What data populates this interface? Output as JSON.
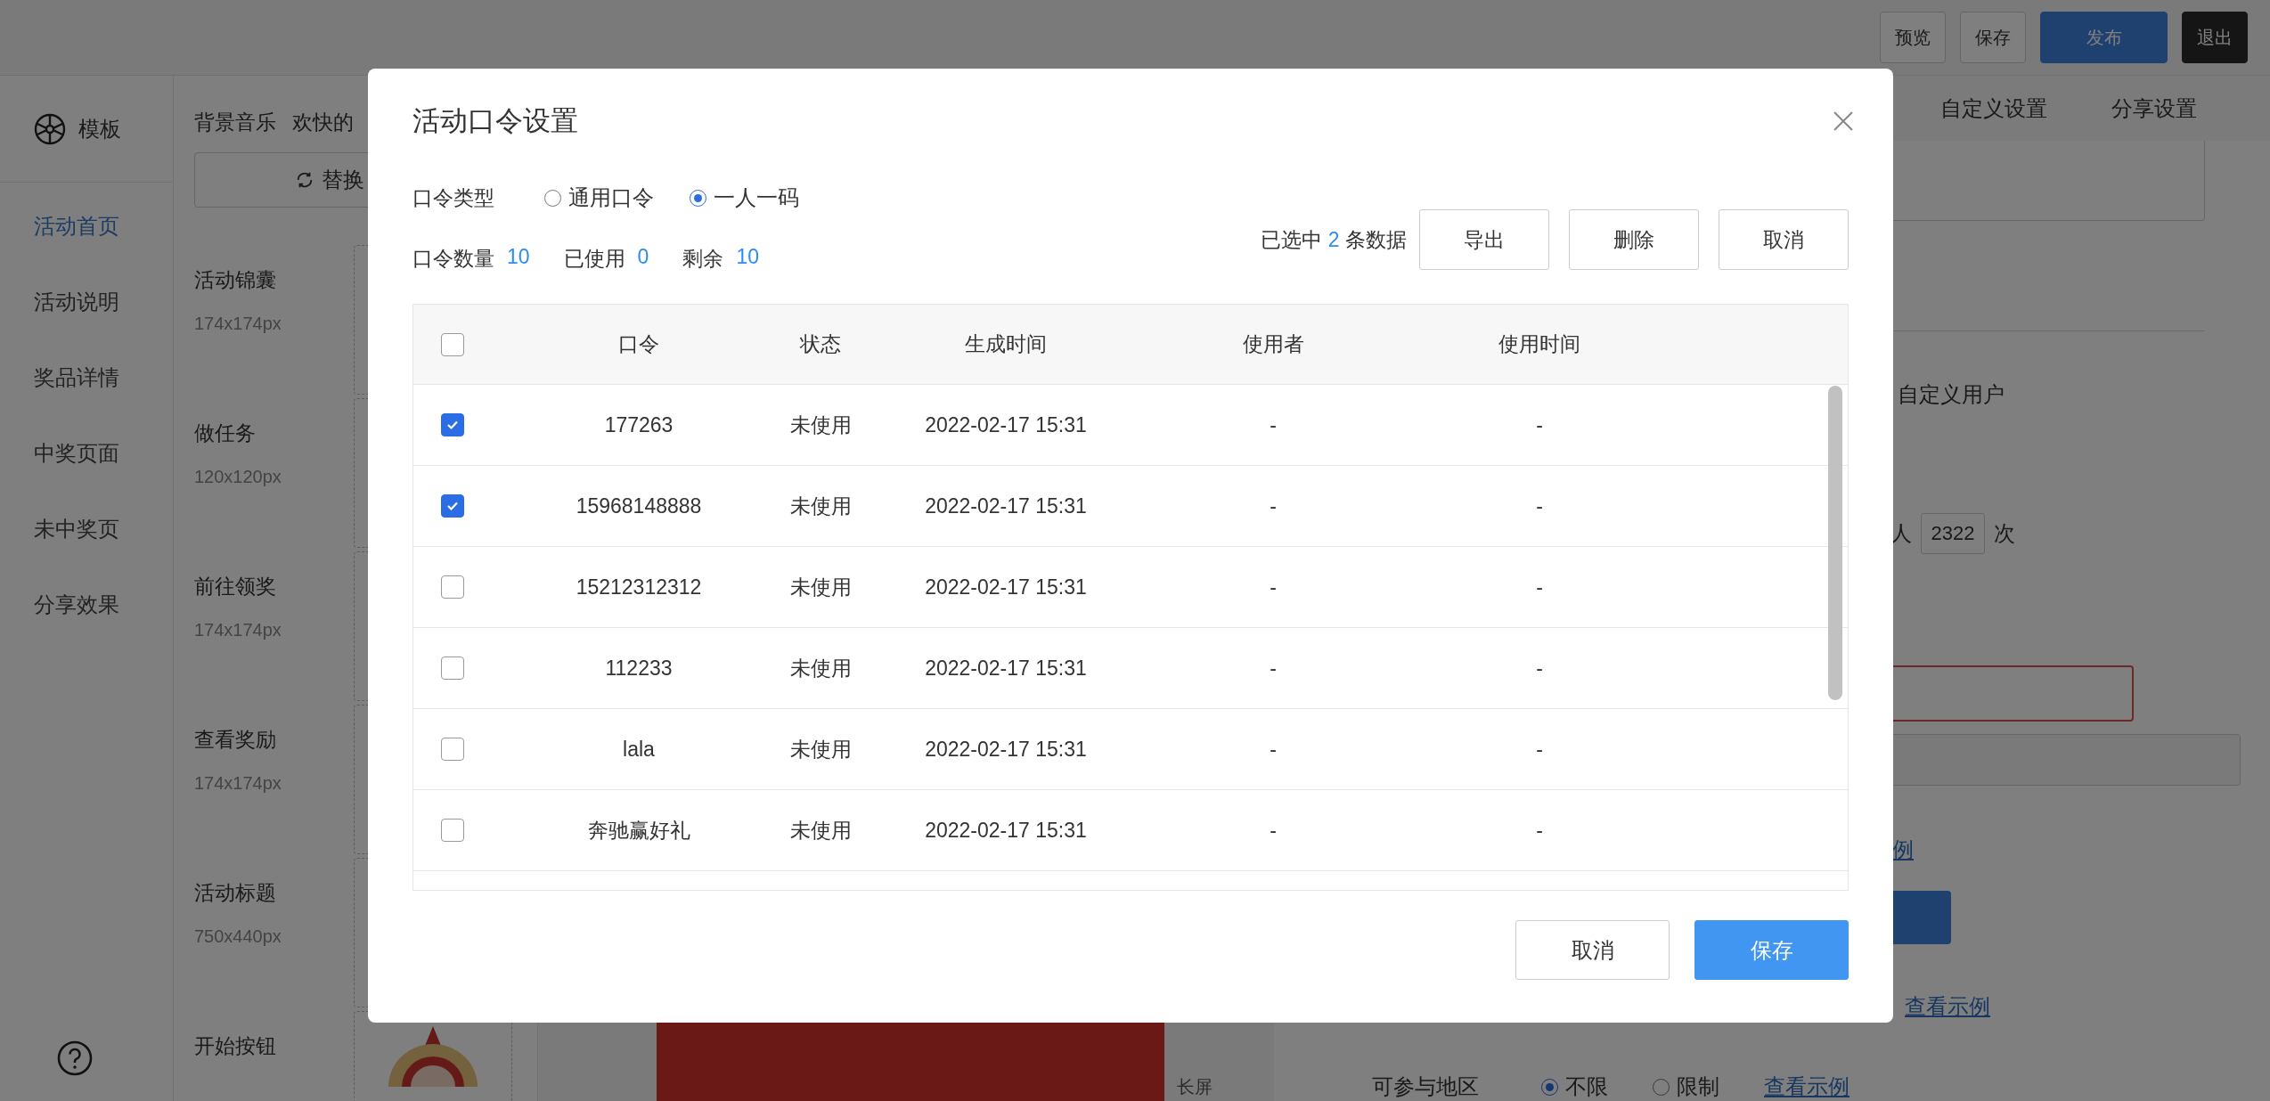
{
  "top_bar": {
    "buttons": [
      {
        "label": "预览",
        "kind": "outline"
      },
      {
        "label": "保存",
        "kind": "outline"
      },
      {
        "label": "发布",
        "kind": "primary"
      },
      {
        "label": "退出",
        "kind": "dark"
      }
    ]
  },
  "sidebar": {
    "header": "模板",
    "items": [
      {
        "label": "活动首页",
        "selected": true
      },
      {
        "label": "活动说明",
        "selected": false
      },
      {
        "label": "奖品详情",
        "selected": false
      },
      {
        "label": "中奖页面",
        "selected": false
      },
      {
        "label": "未中奖页",
        "selected": false
      },
      {
        "label": "分享效果",
        "selected": false
      }
    ]
  },
  "assets": {
    "music_label": "背景音乐",
    "music_name": "欢快的",
    "replace_button": "替换",
    "items": [
      {
        "name": "活动锦囊",
        "size": "174x174px"
      },
      {
        "name": "做任务",
        "size": "120x120px"
      },
      {
        "name": "前往领奖",
        "size": "174x174px"
      },
      {
        "name": "查看奖励",
        "size": "174x174px"
      },
      {
        "name": "活动标题",
        "size": "750x440px"
      },
      {
        "name": "开始按钮"
      }
    ]
  },
  "canvas": {
    "caption": "长屏"
  },
  "settings_panel": {
    "tabs": [
      {
        "label": "自定义设置",
        "selected": false
      },
      {
        "label": "分享设置",
        "selected": false
      }
    ],
    "custom_user_label": "自定义用户",
    "limit": {
      "prefix": "人",
      "value": "2322",
      "suffix": "次"
    },
    "link_fragment": "例",
    "example_link": "查看示例",
    "region": {
      "label": "可参与地区",
      "options": [
        {
          "label": "不限",
          "selected": true
        },
        {
          "label": "限制",
          "selected": false
        }
      ],
      "link": "查看示例"
    }
  },
  "dialog": {
    "title": "活动口令设置",
    "type": {
      "label": "口令类型",
      "options": [
        {
          "label": "通用口令",
          "selected": false
        },
        {
          "label": "一人一码",
          "selected": true
        }
      ]
    },
    "stats": [
      {
        "label": "口令数量",
        "value": "10"
      },
      {
        "label": "已使用",
        "value": "0"
      },
      {
        "label": "剩余",
        "value": "10"
      }
    ],
    "selection": {
      "prefix": "已选中",
      "count": "2",
      "suffix": "条数据"
    },
    "actions": [
      "导出",
      "删除",
      "取消"
    ],
    "table": {
      "header_checked": false,
      "columns": [
        "口令",
        "状态",
        "生成时间",
        "使用者",
        "使用时间"
      ],
      "rows": [
        {
          "checked": true,
          "cells": [
            "177263",
            "未使用",
            "2022-02-17 15:31",
            "-",
            "-"
          ]
        },
        {
          "checked": true,
          "cells": [
            "15968148888",
            "未使用",
            "2022-02-17 15:31",
            "-",
            "-"
          ]
        },
        {
          "checked": false,
          "cells": [
            "15212312312",
            "未使用",
            "2022-02-17 15:31",
            "-",
            "-"
          ]
        },
        {
          "checked": false,
          "cells": [
            "112233",
            "未使用",
            "2022-02-17 15:31",
            "-",
            "-"
          ]
        },
        {
          "checked": false,
          "cells": [
            "lala",
            "未使用",
            "2022-02-17 15:31",
            "-",
            "-"
          ]
        },
        {
          "checked": false,
          "cells": [
            "奔驰赢好礼",
            "未使用",
            "2022-02-17 15:31",
            "-",
            "-"
          ]
        }
      ]
    },
    "footer": [
      {
        "label": "取消",
        "kind": "default"
      },
      {
        "label": "保存",
        "kind": "primary"
      }
    ]
  }
}
